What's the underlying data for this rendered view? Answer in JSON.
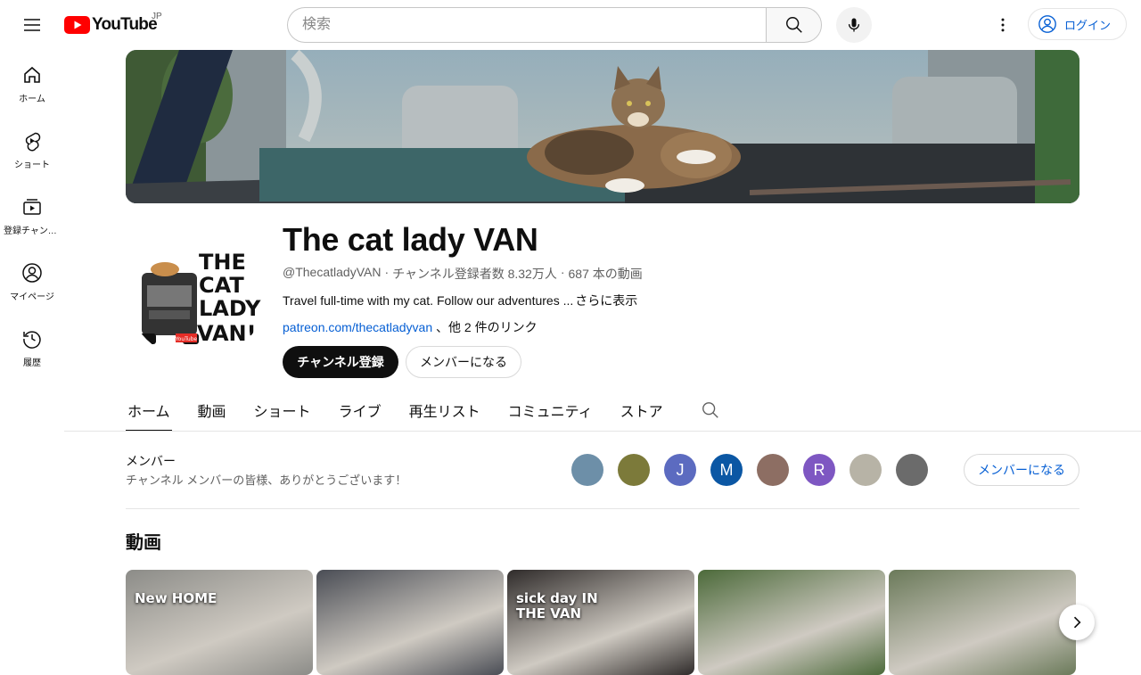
{
  "header": {
    "logo_text": "YouTube",
    "region": "JP",
    "search_placeholder": "検索",
    "login_label": "ログイン"
  },
  "rail": [
    {
      "icon": "home-icon",
      "label": "ホーム"
    },
    {
      "icon": "shorts-icon",
      "label": "ショート"
    },
    {
      "icon": "subscriptions-icon",
      "label": "登録チャンネル"
    },
    {
      "icon": "account-icon",
      "label": "マイページ"
    },
    {
      "icon": "history-icon",
      "label": "履歴"
    }
  ],
  "channel": {
    "name": "The cat lady VAN",
    "handle": "@ThecatladyVAN",
    "subscribers": "チャンネル登録者数 8.32万人",
    "video_count": "687 本の動画",
    "description": "Travel full-time with my cat. Follow our adventures ...",
    "more_label": "さらに表示",
    "link": "patreon.com/thecatladyvan",
    "other_links": "、他 2 件のリンク",
    "subscribe_label": "チャンネル登録",
    "join_label": "メンバーになる",
    "avatar_text": [
      "THE",
      "CAT",
      "LADY",
      "VAN!"
    ]
  },
  "tabs": [
    {
      "label": "ホーム",
      "active": true
    },
    {
      "label": "動画",
      "active": false
    },
    {
      "label": "ショート",
      "active": false
    },
    {
      "label": "ライブ",
      "active": false
    },
    {
      "label": "再生リスト",
      "active": false
    },
    {
      "label": "コミュニティ",
      "active": false
    },
    {
      "label": "ストア",
      "active": false
    }
  ],
  "members": {
    "title": "メンバー",
    "subtitle": "チャンネル メンバーの皆様、ありがとうございます！",
    "join_label": "メンバーになる",
    "avatars": [
      {
        "initial": "",
        "color": "#6d8fa8"
      },
      {
        "initial": "",
        "color": "#7c7a3a"
      },
      {
        "initial": "J",
        "color": "#5c6bc0"
      },
      {
        "initial": "M",
        "color": "#0b57a4"
      },
      {
        "initial": "",
        "color": "#8d6e63"
      },
      {
        "initial": "R",
        "color": "#7e57c2"
      },
      {
        "initial": "",
        "color": "#b7b3a6"
      },
      {
        "initial": "",
        "color": "#6b6b6b"
      }
    ]
  },
  "videos": {
    "section_title": "動画",
    "thumbnails": [
      {
        "overlay": "New HOME",
        "bg": "#8c8c88"
      },
      {
        "overlay": "",
        "bg": "#4a4d55"
      },
      {
        "overlay": "sick day IN THE VAN",
        "bg": "#2f2b2a"
      },
      {
        "overlay": "",
        "bg": "#4c6a3a"
      },
      {
        "overlay": "",
        "bg": "#6b7a5a"
      }
    ]
  }
}
